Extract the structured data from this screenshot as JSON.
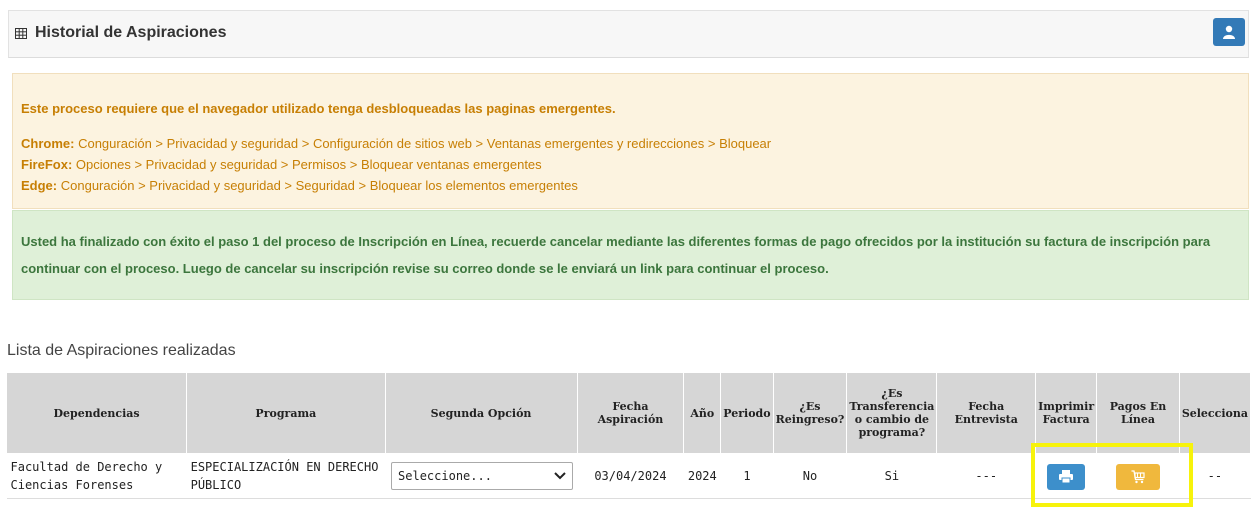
{
  "header": {
    "title": "Historial de Aspiraciones"
  },
  "warning": {
    "line1": "Este proceso requiere que el navegador utilizado tenga desbloqueadas las paginas emergentes.",
    "chrome_label": "Chrome:",
    "chrome_path": "Conguración > Privacidad y seguridad > Configuración de sitios web > Ventanas emergentes y redirecciones > Bloquear",
    "firefox_label": "FireFox:",
    "firefox_path": "Opciones > Privacidad y seguridad > Permisos > Bloquear ventanas emergentes",
    "edge_label": "Edge:",
    "edge_path": "Conguración > Privacidad y seguridad > Seguridad > Bloquear los elementos emergentes"
  },
  "success": {
    "message": "Usted ha finalizado con éxito el paso 1 del proceso de Inscripción en Línea, recuerde cancelar mediante las diferentes formas de pago ofrecidos por la institución su factura de inscripción para continuar con el proceso. Luego de cancelar su inscripción revise su correo donde se le enviará un link para continuar el proceso."
  },
  "list": {
    "title": "Lista de Aspiraciones realizadas",
    "columns": [
      "Dependencias",
      "Programa",
      "Segunda Opción",
      "Fecha Aspiración",
      "Año",
      "Periodo",
      "¿Es Reingreso?",
      "¿Es Transferencia o cambio de programa?",
      "Fecha Entrevista",
      "Imprimir Factura",
      "Pagos En Línea",
      "Selecciona"
    ],
    "rows": [
      {
        "dependencia": "Facultad de Derecho y Ciencias Forenses",
        "programa": "ESPECIALIZACIÓN EN DERECHO PÚBLICO",
        "segunda_opcion": "Seleccione...",
        "fecha_aspiracion": "03/04/2024",
        "anio": "2024",
        "periodo": "1",
        "reingreso": "No",
        "transferencia": "Si",
        "fecha_entrevista": "---",
        "selecciona": "--"
      }
    ]
  },
  "colors": {
    "primary_button": "#337ab7",
    "print_button": "#3d8fcb",
    "pay_button": "#f0b83d",
    "warning_bg": "#fcf3e0",
    "warning_text": "#c77f04",
    "success_bg": "#dff0d8",
    "success_text": "#3c763d",
    "highlight": "#f7f30b"
  },
  "icons": {
    "header": "table-grid-icon",
    "user": "user-icon",
    "print": "printer-icon",
    "pay": "shopping-cart-icon",
    "select": "chevron-down-icon"
  }
}
